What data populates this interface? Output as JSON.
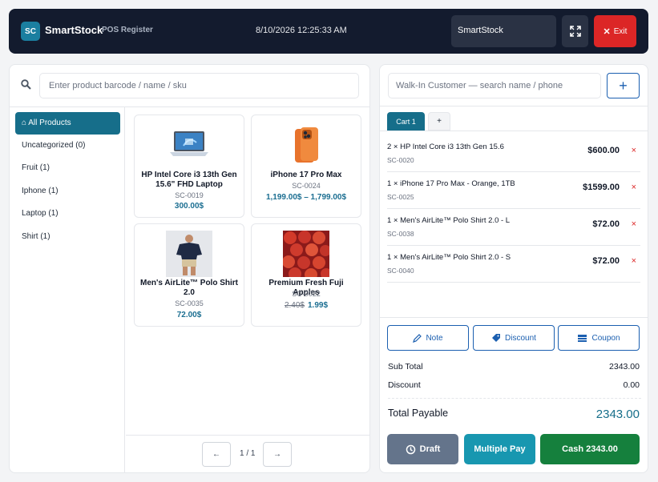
{
  "header": {
    "logo_text": "SC",
    "brand": "SmartStock",
    "subtitle": "POS Register",
    "datetime": "8/10/2026 12:25:33 AM",
    "store": "SmartStock",
    "exit_label": "Exit"
  },
  "search": {
    "placeholder": "Enter product barcode / name / sku"
  },
  "categories": [
    {
      "label": "⌂ All Products",
      "active": true
    },
    {
      "label": "Uncategorized (0)"
    },
    {
      "label": "Fruit (1)"
    },
    {
      "label": "Iphone (1)"
    },
    {
      "label": "Laptop (1)"
    },
    {
      "label": "Shirt (1)"
    }
  ],
  "products": [
    {
      "name": "HP Intel Core i3 13th Gen 15.6\" FHD Laptop",
      "sku": "SC-0019",
      "price": "300.00$",
      "image": "laptop-image"
    },
    {
      "name": "iPhone 17 Pro Max",
      "sku": "SC-0024",
      "price": "1,199.00$ – 1,799.00$",
      "image": "phone-image"
    },
    {
      "name": "Men's AirLite™ Polo Shirt 2.0",
      "sku": "SC-0035",
      "price": "72.00$",
      "image": "shirt-image"
    },
    {
      "name": "Premium Fresh Fuji Apples",
      "sku": "SC-0022",
      "old_price": "2.40$",
      "price": "1.99$",
      "image": "apples-image"
    }
  ],
  "pagination": {
    "prev": "←",
    "text": "1 / 1",
    "next": "→"
  },
  "customer": {
    "placeholder": "Walk-In Customer — search name / phone",
    "add_label": "+"
  },
  "cart_tabs": {
    "active": "Cart 1",
    "add": "+"
  },
  "cart": [
    {
      "name": "2 × HP Intel Core i3 13th Gen 15.6",
      "sku": "SC-0020",
      "price": "$600.00"
    },
    {
      "name": "1 × iPhone 17 Pro Max - Orange, 1TB",
      "sku": "SC-0025",
      "price": "$1599.00"
    },
    {
      "name": "1 × Men's AirLite™ Polo Shirt 2.0 - L",
      "sku": "SC-0038",
      "price": "$72.00"
    },
    {
      "name": "1 × Men's AirLite™ Polo Shirt 2.0 - S",
      "sku": "SC-0040",
      "price": "$72.00"
    }
  ],
  "remove_symbol": "×",
  "actions": {
    "note": "Note",
    "discount": "Discount",
    "coupon": "Coupon"
  },
  "summary": {
    "subtotal_label": "Sub Total",
    "subtotal": "2343.00",
    "discount_label": "Discount",
    "discount": "0.00",
    "total_label": "Total Payable",
    "total": "2343.00"
  },
  "payment": {
    "draft": "Draft",
    "multiple": "Multiple Pay",
    "cash": "Cash 2343.00"
  },
  "colors": {
    "primary": "#166e8a",
    "header": "#131b2e",
    "exit": "#dc2626",
    "draft": "#64748b",
    "multiple": "#1897b0",
    "cash": "#15803d"
  }
}
